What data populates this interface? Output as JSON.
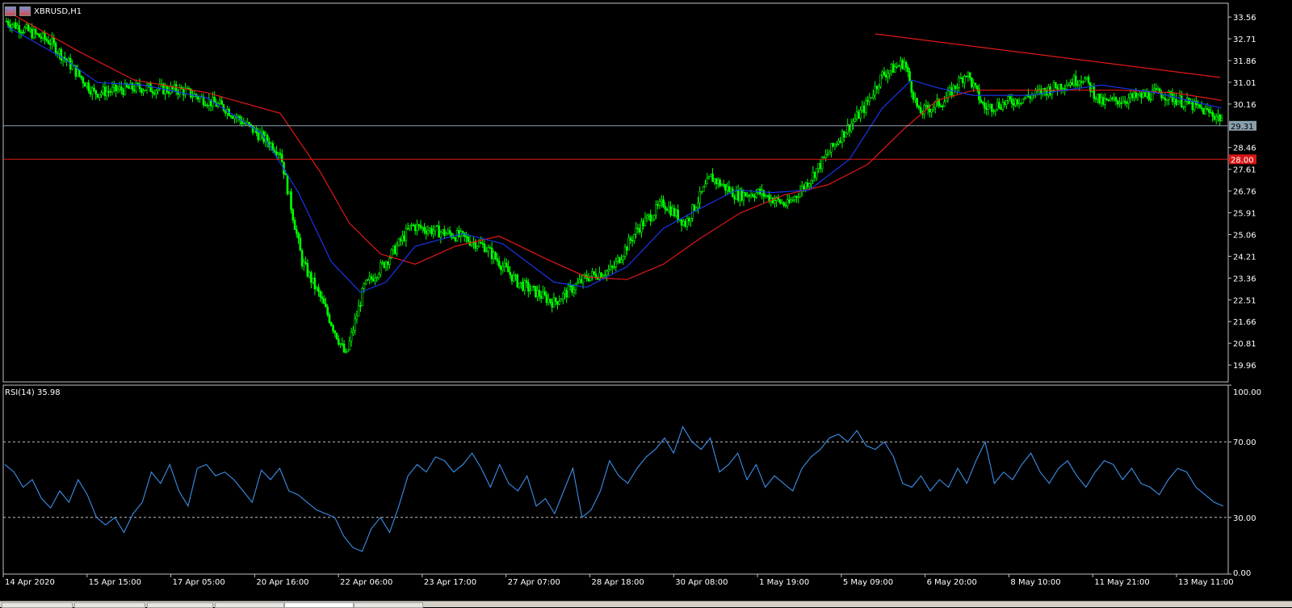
{
  "window": {
    "title": "XBRUSD,H1",
    "flag_icon": "us-flag-icon"
  },
  "colors": {
    "background": "#000000",
    "border": "#c0c0c0",
    "candle": "#00ff00",
    "ma_fast": "#1a34e8",
    "ma_slow": "#e01818",
    "trendline": "#e01818",
    "support_line": "#e01818",
    "price_line": "#8aa0ae",
    "rsi_line": "#3d8ee8",
    "level_line": "#c0c0c0",
    "support_tag": "#d91515",
    "price_tag": "#8aa0ae"
  },
  "price_axis": {
    "ticks": [
      "33.56",
      "32.71",
      "31.86",
      "31.01",
      "30.16",
      "28.46",
      "27.61",
      "26.76",
      "25.91",
      "25.06",
      "24.21",
      "23.36",
      "22.51",
      "21.66",
      "20.81",
      "19.96"
    ],
    "current_price_tag": "29.31",
    "support_level_tag": "28.00"
  },
  "rsi": {
    "label": "RSI(14) 35.98",
    "axis_ticks": [
      "100.00",
      "70.00",
      "30.00",
      "0.00"
    ],
    "levels": [
      70,
      30
    ]
  },
  "time_axis": {
    "labels": [
      "14 Apr 2020",
      "15 Apr 15:00",
      "17 Apr 05:00",
      "20 Apr 16:00",
      "22 Apr 06:00",
      "23 Apr 17:00",
      "27 Apr 07:00",
      "28 Apr 18:00",
      "30 Apr 08:00",
      "1 May 19:00",
      "5 May 09:00",
      "6 May 20:00",
      "8 May 10:00",
      "11 May 21:00",
      "13 May 11:00"
    ]
  },
  "chart_data": [
    {
      "type": "candlestick",
      "symbol": "XBRUSD",
      "timeframe": "H1",
      "ylim": [
        19.3,
        34.1
      ],
      "horizontal_lines": [
        29.31,
        28.0
      ],
      "trendline": [
        {
          "x": "5 May 09:00",
          "y": 32.9
        },
        {
          "x": "13 May 11:00",
          "y": 31.2
        }
      ],
      "close_path": [
        {
          "x": 0,
          "y": 33.4
        },
        {
          "x": 24,
          "y": 32.6
        },
        {
          "x": 48,
          "y": 30.6
        },
        {
          "x": 72,
          "y": 30.8
        },
        {
          "x": 96,
          "y": 30.7
        },
        {
          "x": 120,
          "y": 30.0
        },
        {
          "x": 150,
          "y": 28.3
        },
        {
          "x": 162,
          "y": 24.0
        },
        {
          "x": 172,
          "y": 22.6
        },
        {
          "x": 186,
          "y": 20.3
        },
        {
          "x": 196,
          "y": 23.0
        },
        {
          "x": 210,
          "y": 24.2
        },
        {
          "x": 222,
          "y": 25.4
        },
        {
          "x": 248,
          "y": 25.0
        },
        {
          "x": 262,
          "y": 24.6
        },
        {
          "x": 280,
          "y": 23.2
        },
        {
          "x": 300,
          "y": 22.4
        },
        {
          "x": 318,
          "y": 23.4
        },
        {
          "x": 332,
          "y": 23.7
        },
        {
          "x": 346,
          "y": 25.3
        },
        {
          "x": 360,
          "y": 26.3
        },
        {
          "x": 372,
          "y": 25.5
        },
        {
          "x": 386,
          "y": 27.3
        },
        {
          "x": 400,
          "y": 26.6
        },
        {
          "x": 412,
          "y": 26.7
        },
        {
          "x": 428,
          "y": 26.2
        },
        {
          "x": 440,
          "y": 27.2
        },
        {
          "x": 456,
          "y": 28.8
        },
        {
          "x": 470,
          "y": 30.0
        },
        {
          "x": 480,
          "y": 31.3
        },
        {
          "x": 492,
          "y": 31.8
        },
        {
          "x": 500,
          "y": 29.8
        },
        {
          "x": 514,
          "y": 30.3
        },
        {
          "x": 526,
          "y": 31.4
        },
        {
          "x": 536,
          "y": 30.0
        },
        {
          "x": 558,
          "y": 30.4
        },
        {
          "x": 574,
          "y": 30.8
        },
        {
          "x": 590,
          "y": 31.2
        },
        {
          "x": 600,
          "y": 30.2
        },
        {
          "x": 618,
          "y": 30.4
        },
        {
          "x": 632,
          "y": 30.6
        },
        {
          "x": 650,
          "y": 30.1
        },
        {
          "x": 666,
          "y": 29.6
        }
      ],
      "ma_fast": [
        {
          "x": 0,
          "y": 33.2
        },
        {
          "x": 30,
          "y": 32.0
        },
        {
          "x": 50,
          "y": 31.0
        },
        {
          "x": 75,
          "y": 30.9
        },
        {
          "x": 110,
          "y": 30.4
        },
        {
          "x": 140,
          "y": 29.0
        },
        {
          "x": 160,
          "y": 26.7
        },
        {
          "x": 178,
          "y": 24.0
        },
        {
          "x": 194,
          "y": 22.8
        },
        {
          "x": 208,
          "y": 23.2
        },
        {
          "x": 224,
          "y": 24.6
        },
        {
          "x": 250,
          "y": 25.1
        },
        {
          "x": 272,
          "y": 24.7
        },
        {
          "x": 300,
          "y": 23.2
        },
        {
          "x": 318,
          "y": 23.0
        },
        {
          "x": 340,
          "y": 23.8
        },
        {
          "x": 360,
          "y": 25.3
        },
        {
          "x": 378,
          "y": 26.0
        },
        {
          "x": 400,
          "y": 26.8
        },
        {
          "x": 420,
          "y": 26.7
        },
        {
          "x": 440,
          "y": 26.8
        },
        {
          "x": 462,
          "y": 28.0
        },
        {
          "x": 480,
          "y": 30.0
        },
        {
          "x": 496,
          "y": 31.1
        },
        {
          "x": 510,
          "y": 30.8
        },
        {
          "x": 530,
          "y": 30.5
        },
        {
          "x": 560,
          "y": 30.5
        },
        {
          "x": 600,
          "y": 30.9
        },
        {
          "x": 630,
          "y": 30.6
        },
        {
          "x": 666,
          "y": 30.0
        }
      ],
      "ma_slow": [
        {
          "x": 0,
          "y": 33.8
        },
        {
          "x": 40,
          "y": 32.2
        },
        {
          "x": 70,
          "y": 31.1
        },
        {
          "x": 110,
          "y": 30.6
        },
        {
          "x": 150,
          "y": 29.8
        },
        {
          "x": 172,
          "y": 27.5
        },
        {
          "x": 188,
          "y": 25.5
        },
        {
          "x": 205,
          "y": 24.3
        },
        {
          "x": 224,
          "y": 23.9
        },
        {
          "x": 246,
          "y": 24.6
        },
        {
          "x": 270,
          "y": 25.0
        },
        {
          "x": 296,
          "y": 24.1
        },
        {
          "x": 318,
          "y": 23.4
        },
        {
          "x": 340,
          "y": 23.3
        },
        {
          "x": 360,
          "y": 23.9
        },
        {
          "x": 380,
          "y": 24.9
        },
        {
          "x": 402,
          "y": 25.9
        },
        {
          "x": 426,
          "y": 26.6
        },
        {
          "x": 450,
          "y": 27.0
        },
        {
          "x": 472,
          "y": 27.8
        },
        {
          "x": 492,
          "y": 29.2
        },
        {
          "x": 510,
          "y": 30.3
        },
        {
          "x": 530,
          "y": 30.7
        },
        {
          "x": 570,
          "y": 30.7
        },
        {
          "x": 610,
          "y": 30.7
        },
        {
          "x": 640,
          "y": 30.6
        },
        {
          "x": 666,
          "y": 30.3
        }
      ]
    },
    {
      "type": "line",
      "series": [
        {
          "name": "RSI(14)",
          "values": [
            58,
            54,
            46,
            50,
            40,
            35,
            44,
            38,
            50,
            42,
            30,
            26,
            30,
            22,
            32,
            38,
            54,
            48,
            58,
            44,
            36,
            56,
            58,
            52,
            54,
            50,
            44,
            38,
            55,
            50,
            56,
            44,
            42,
            38,
            34,
            32,
            30,
            20,
            14,
            12,
            24,
            30,
            22,
            36,
            52,
            58,
            54,
            62,
            60,
            54,
            58,
            64,
            56,
            46,
            58,
            48,
            44,
            52,
            36,
            40,
            32,
            44,
            56,
            30,
            34,
            44,
            60,
            52,
            48,
            56,
            62,
            66,
            72,
            64,
            78,
            70,
            66,
            72,
            54,
            58,
            64,
            50,
            58,
            46,
            52,
            48,
            44,
            56,
            62,
            66,
            72,
            74,
            70,
            76,
            68,
            66,
            70,
            62,
            48,
            46,
            52,
            44,
            50,
            46,
            56,
            48,
            60,
            70,
            48,
            54,
            50,
            58,
            64,
            54,
            48,
            56,
            60,
            52,
            46,
            54,
            60,
            58,
            50,
            56,
            48,
            46,
            42,
            50,
            56,
            54,
            46,
            42,
            38,
            36
          ]
        }
      ],
      "ylim": [
        0,
        100
      ],
      "levels": [
        70,
        30
      ]
    }
  ]
}
